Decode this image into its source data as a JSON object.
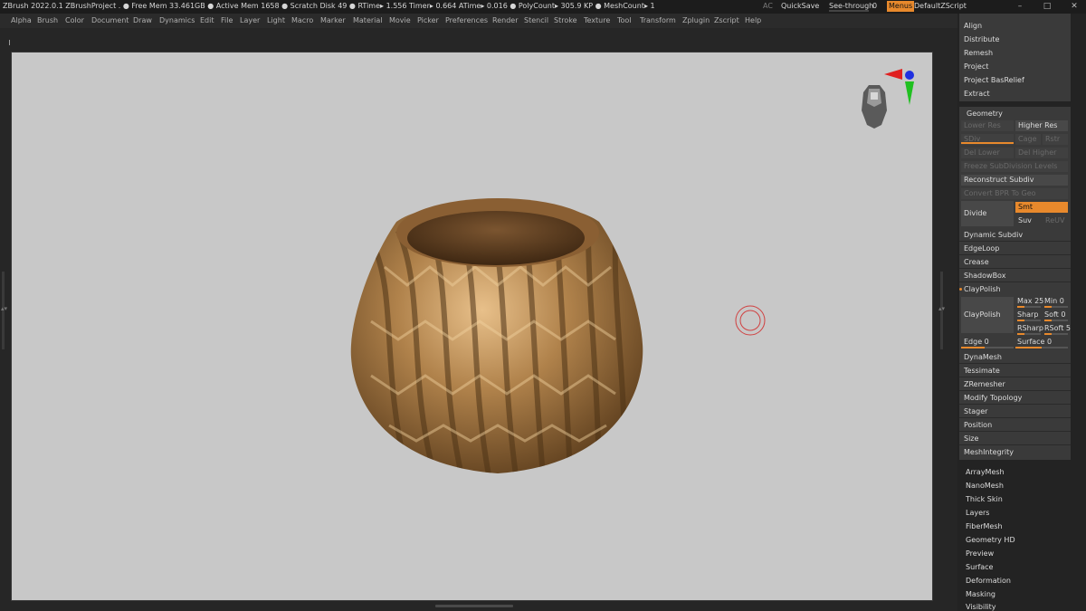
{
  "titlebar": {
    "info": "ZBrush 2022.0.1    ZBrushProject   . ● Free Mem 33.461GB ● Active Mem 1658 ● Scratch Disk 49 ●  RTime▸ 1.556 Timer▸ 0.664 ATime▸ 0.016 ● PolyCount▸ 305.9 KP  ● MeshCount▸ 1",
    "ac": "AC",
    "quicksave": "QuickSave",
    "see_through_label": "See-through",
    "see_through_value": "0",
    "see_through_level": 0,
    "menus": "Menus",
    "default_zscript": "DefaultZScript",
    "minimize": "–",
    "maximize": "□",
    "close": "✕"
  },
  "menubar": {
    "items": [
      "Alpha",
      "Brush",
      "Color",
      "Document",
      "Draw",
      "Dynamics",
      "Edit",
      "File",
      "Layer",
      "Light",
      "Macro",
      "Marker",
      "Material",
      "Movie",
      "Picker",
      "Preferences",
      "Render",
      "Stencil",
      "Stroke",
      "Texture",
      "Tool",
      "Transform",
      "Zplugin",
      "Zscript",
      "Help"
    ]
  },
  "panel": {
    "top_items": [
      "Align",
      "Distribute",
      "Remesh",
      "Project",
      "Project BasRelief",
      "Extract"
    ],
    "geometry": {
      "header": "Geometry",
      "lower_res": "Lower Res",
      "higher_res": "Higher Res",
      "sdiv": "SDiv",
      "cage": "Cage",
      "rstr": "Rstr",
      "del_lower": "Del Lower",
      "del_higher": "Del Higher",
      "freeze": "Freeze SubDivision Levels",
      "reconstruct": "Reconstruct Subdiv",
      "convert_bpr": "Convert BPR To Geo",
      "divide": "Divide",
      "smt": "Smt",
      "suv": "Suv",
      "reuv": "ReUV",
      "dynamic_subdiv": "Dynamic Subdiv",
      "edgeloop": "EdgeLoop",
      "crease": "Crease",
      "shadowbox": "ShadowBox",
      "claypolish_header": "ClayPolish",
      "claypolish": "ClayPolish",
      "max": "Max 25",
      "min": "Min 0",
      "sharp": "Sharp",
      "soft": "Soft 0",
      "rsharp": "RSharp",
      "rsoft": "RSoft 5",
      "edge": "Edge 0",
      "surface": "Surface 0",
      "rest": [
        "DynaMesh",
        "Tessimate",
        "ZRemesher",
        "Modify Topology",
        "Stager",
        "Position",
        "Size",
        "MeshIntegrity"
      ]
    },
    "sub_menus": [
      "ArrayMesh",
      "NanoMesh",
      "Thick Skin",
      "Layers",
      "FiberMesh",
      "Geometry HD",
      "Preview",
      "Surface",
      "Deformation",
      "Masking",
      "Visibility"
    ]
  },
  "colors": {
    "accent": "#e8892c",
    "viewport_bg": "#c8c8c8",
    "model_bronze": "#b0824b"
  }
}
